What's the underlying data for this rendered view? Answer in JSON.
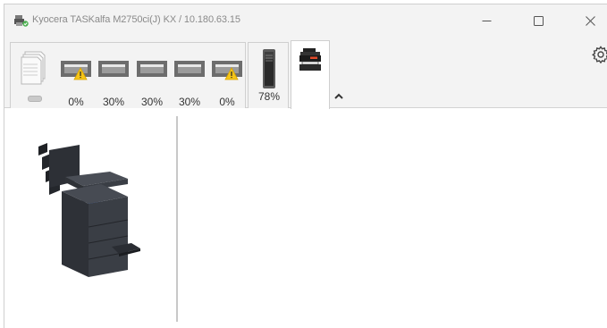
{
  "window": {
    "title": "Kyocera TASKalfa M2750ci(J) KX / 10.180.63.15",
    "controls": {
      "minimize_icon": "minimize-icon",
      "maximize_icon": "maximize-icon",
      "close_icon": "close-icon"
    }
  },
  "toolbar": {
    "paper_trays": [
      {
        "label": "0%",
        "warning": true
      },
      {
        "label": "30%",
        "warning": false
      },
      {
        "label": "30%",
        "warning": false
      },
      {
        "label": "30%",
        "warning": false
      },
      {
        "label": "0%",
        "warning": true
      }
    ],
    "toner": {
      "label": "78%",
      "level_percent": 78
    },
    "icons": {
      "paper_stack": "paper-stack-icon",
      "device_tab": "printer-device-icon",
      "collapse": "collapse-arrow-icon",
      "settings": "gear-icon"
    }
  },
  "colors": {
    "titlebar_bg": "#f3f3f3",
    "tray_gray": "#6d6d6d",
    "warning_yellow": "#f5c518",
    "printer_body": "#3a3d44"
  }
}
